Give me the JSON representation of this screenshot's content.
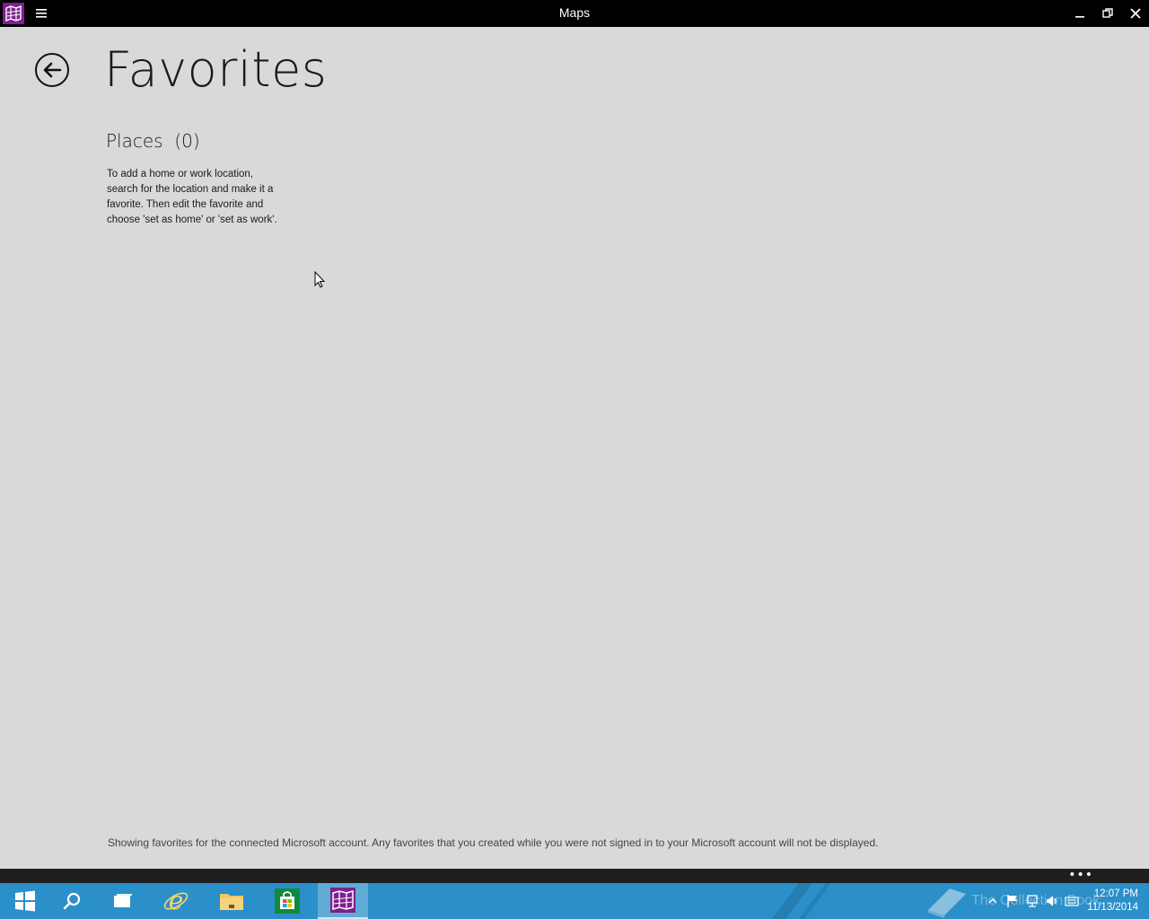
{
  "window": {
    "title": "Maps",
    "app_icon": "maps-app-icon",
    "menu_icon": "hamburger-menu-icon",
    "controls": [
      "minimize-icon",
      "restore-icon",
      "close-icon"
    ]
  },
  "page": {
    "back_icon": "back-arrow-icon",
    "title": "Favorites",
    "places_label": "Places",
    "places_count": "(0)",
    "help_text": "To add a home or work location, search for the location and make it a favorite. Then edit the favorite and choose 'set as home' or 'set as work'.",
    "footer_note": "Showing favorites for the connected Microsoft account. Any favorites that you created while you were not signed in to your Microsoft account will not be displayed."
  },
  "appbar": {
    "more_label": "•••"
  },
  "taskbar": {
    "items": [
      {
        "name": "start-button",
        "icon": "windows-logo-icon"
      },
      {
        "name": "search-button",
        "icon": "search-icon"
      },
      {
        "name": "task-view-button",
        "icon": "task-view-icon"
      },
      {
        "name": "internet-explorer-button",
        "icon": "internet-explorer-icon"
      },
      {
        "name": "file-explorer-button",
        "icon": "folder-icon"
      },
      {
        "name": "store-button",
        "icon": "store-icon"
      },
      {
        "name": "maps-taskbar-button",
        "icon": "maps-app-icon",
        "active": true
      }
    ],
    "watermark": "The Collection Book",
    "tray_icons": [
      "show-hidden-icons-chevron",
      "flag-icon",
      "network-icon",
      "volume-icon",
      "keyboard-icon"
    ],
    "time": "12:07 PM",
    "date": "11/13/2014"
  },
  "colors": {
    "background": "#d9d9d9",
    "titlebar": "#000000",
    "taskbar": "#2b8fc9",
    "maps_accent": "#7d1f8f"
  }
}
